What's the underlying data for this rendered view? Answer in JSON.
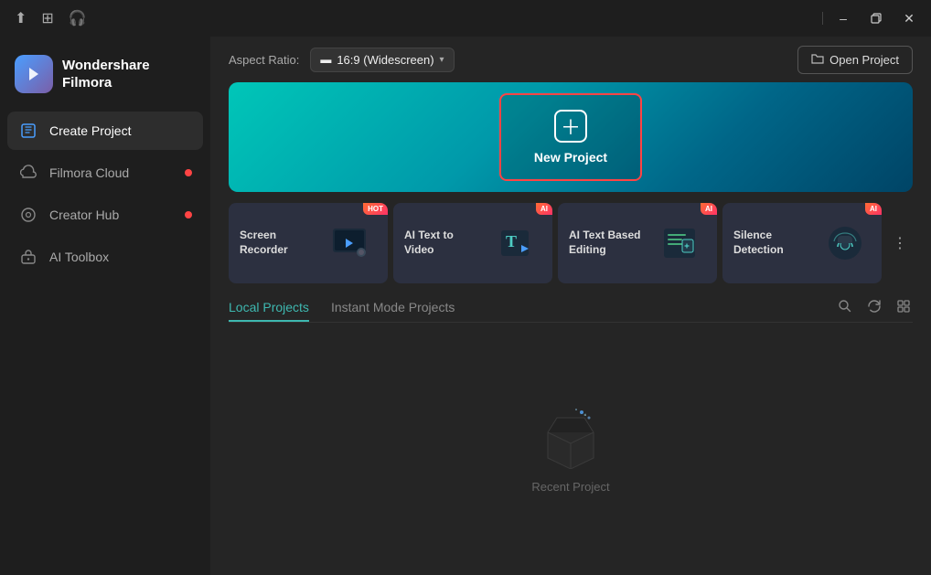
{
  "titlebar": {
    "tools": [
      "upload-icon",
      "grid-icon",
      "headset-icon"
    ],
    "controls": [
      "minimize-icon",
      "restore-icon",
      "close-icon"
    ]
  },
  "logo": {
    "text_line1": "Wondershare",
    "text_line2": "Filmora"
  },
  "sidebar": {
    "items": [
      {
        "id": "create-project",
        "label": "Create Project",
        "active": true,
        "badge": false
      },
      {
        "id": "filmora-cloud",
        "label": "Filmora Cloud",
        "active": false,
        "badge": true
      },
      {
        "id": "creator-hub",
        "label": "Creator Hub",
        "active": false,
        "badge": true
      },
      {
        "id": "ai-toolbox",
        "label": "AI Toolbox",
        "active": false,
        "badge": false
      }
    ]
  },
  "topbar": {
    "aspect_label": "Aspect Ratio:",
    "aspect_value": "16:9 (Widescreen)",
    "open_project_label": "Open Project"
  },
  "hero": {
    "new_project_label": "New Project"
  },
  "feature_cards": [
    {
      "id": "screen-recorder",
      "label": "Screen Recorder",
      "badge": "HOT"
    },
    {
      "id": "ai-text-to-video",
      "label": "AI Text to Video",
      "badge": "AI"
    },
    {
      "id": "ai-text-based-editing",
      "label": "AI Text Based Editing",
      "badge": "AI"
    },
    {
      "id": "silence-detection",
      "label": "Silence Detection",
      "badge": "AI"
    }
  ],
  "projects": {
    "tabs": [
      {
        "id": "local-projects",
        "label": "Local Projects",
        "active": true
      },
      {
        "id": "instant-mode",
        "label": "Instant Mode Projects",
        "active": false
      }
    ],
    "empty_label": "Recent Project"
  }
}
